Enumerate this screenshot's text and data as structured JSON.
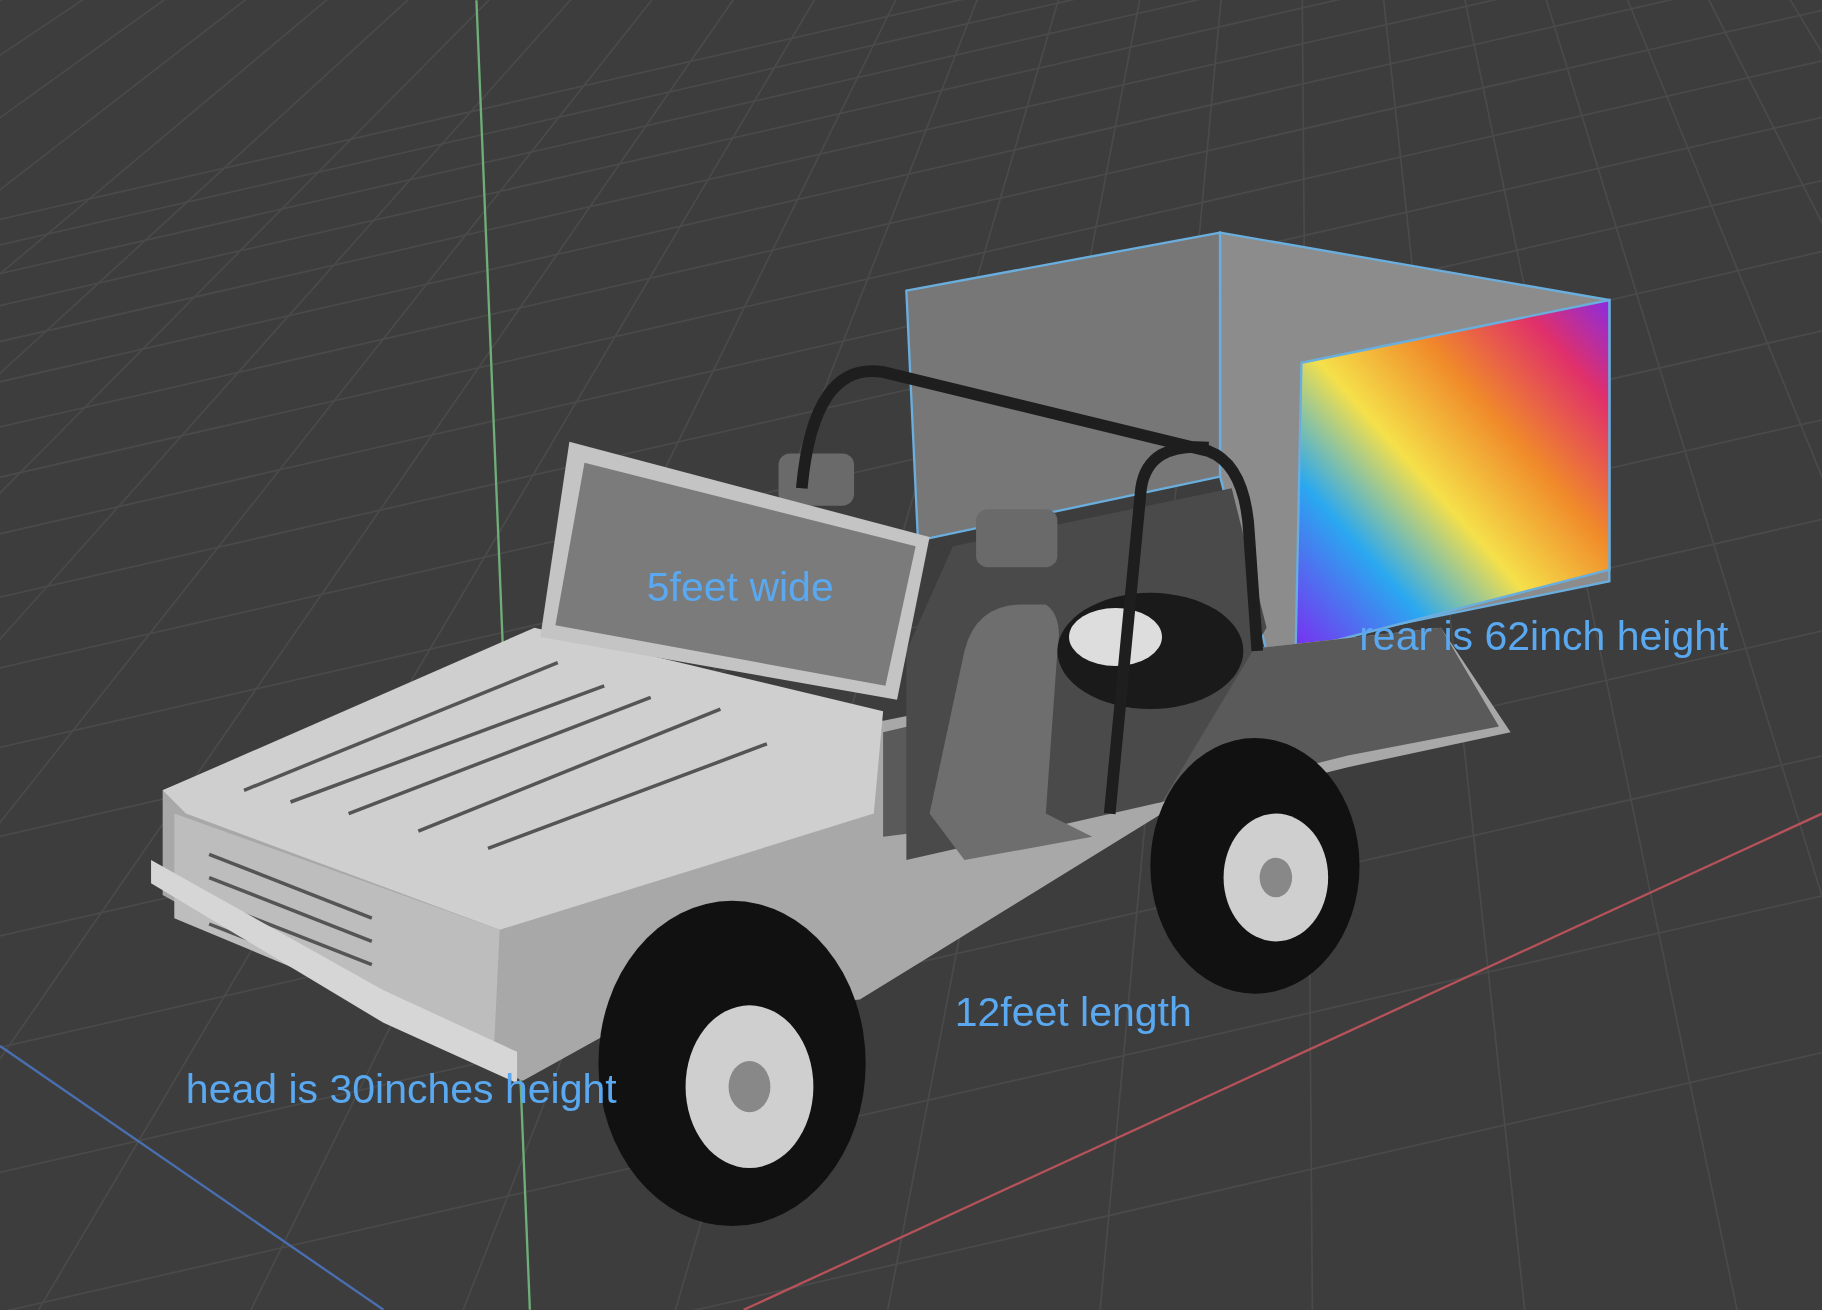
{
  "viewport": {
    "annotations": [
      {
        "text": "5feet wide"
      },
      {
        "text": "rear is 62inch height"
      },
      {
        "text": "12feet length"
      },
      {
        "text": "head is 30inches height"
      }
    ]
  }
}
